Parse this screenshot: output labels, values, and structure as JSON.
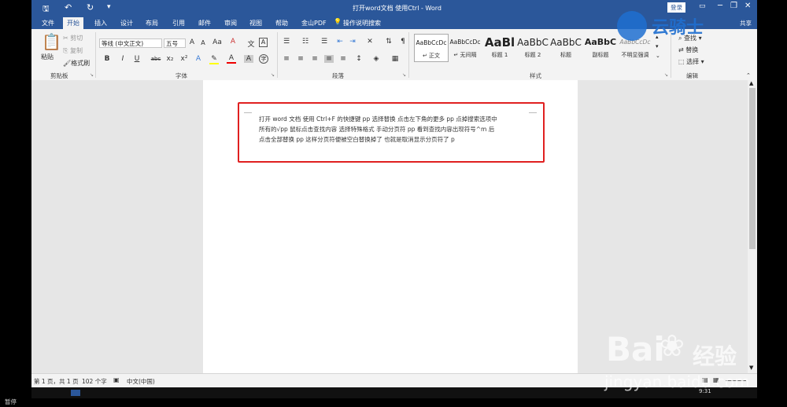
{
  "titlebar": {
    "title": "打开word文档 使用Ctrl - Word",
    "login": "登录"
  },
  "tabs": [
    "文件",
    "开始",
    "插入",
    "设计",
    "布局",
    "引用",
    "邮件",
    "审阅",
    "视图",
    "帮助",
    "金山PDF"
  ],
  "tell_me": "操作说明搜索",
  "share": "共享",
  "clipboard": {
    "paste": "粘贴",
    "cut": "剪切",
    "copy": "复制",
    "format_painter": "格式刷",
    "label": "剪贴板"
  },
  "font": {
    "name": "等线 (中文正文)",
    "size": "五号",
    "label": "字体",
    "bold": "B",
    "italic": "I",
    "underline": "U",
    "strike": "abc",
    "sub": "x₂",
    "sup": "x²",
    "grow": "A",
    "shrink": "A",
    "aa": "Aa",
    "color_a": "A"
  },
  "paragraph": {
    "label": "段落"
  },
  "styles": {
    "label": "样式",
    "items": [
      {
        "preview": "AaBbCcDc",
        "name": "正文"
      },
      {
        "preview": "AaBbCcDc",
        "name": "无间隔"
      },
      {
        "preview": "AaBl",
        "name": "标题 1"
      },
      {
        "preview": "AaBbC",
        "name": "标题 2"
      },
      {
        "preview": "AaBbC",
        "name": "标题"
      },
      {
        "preview": "AaBbC",
        "name": "副标题"
      },
      {
        "preview": "AaBbCcDc",
        "name": "不明显强调"
      }
    ]
  },
  "editing": {
    "find": "查找",
    "replace": "替换",
    "select": "选择",
    "label": "编辑"
  },
  "document": {
    "lines": [
      "打开 word 文档  使用 Ctrl+F 的快捷键 pp 选择替换  点击左下角的更多 pp 点掉搜索选项中",
      "所有的√pp 鼠标点击查找内容  选择特殊格式  手动分页符 pp 看到查找内容出现符号^m 后",
      "点击全部替换 pp 这样分页符便被空白替换掉了  也就是取消显示分页符了 p"
    ]
  },
  "statusbar": {
    "page": "第 1 页，共 1 页",
    "words": "102 个字",
    "lang": "中文(中国)"
  },
  "watermark": {
    "brand": "云骑士",
    "baidu": "Bai",
    "jingyan": "经验",
    "url": "jingyan.baidu.com"
  },
  "bottom": {
    "pause": "暂停",
    "time": "9:31"
  },
  "colors": {
    "word_blue": "#2b579a",
    "highlight_box": "#e02020"
  }
}
